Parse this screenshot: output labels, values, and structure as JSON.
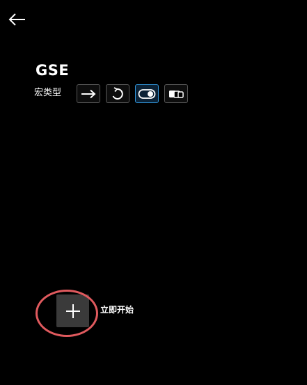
{
  "header": {
    "back_icon": "arrow-left-icon"
  },
  "title": "GSE",
  "macro_type": {
    "label": "宏类型",
    "options": [
      {
        "icon": "arrow-right-icon",
        "selected": false
      },
      {
        "icon": "repeat-icon",
        "selected": false
      },
      {
        "icon": "toggle-icon",
        "selected": true
      },
      {
        "icon": "sequence-icon",
        "selected": false
      }
    ]
  },
  "start": {
    "add_icon": "plus-icon",
    "label": "立即开始"
  },
  "colors": {
    "background": "#000000",
    "selected_accent": "#2f8fd1",
    "highlight_ring": "#e05a5e",
    "add_button": "#3a3a3a"
  }
}
